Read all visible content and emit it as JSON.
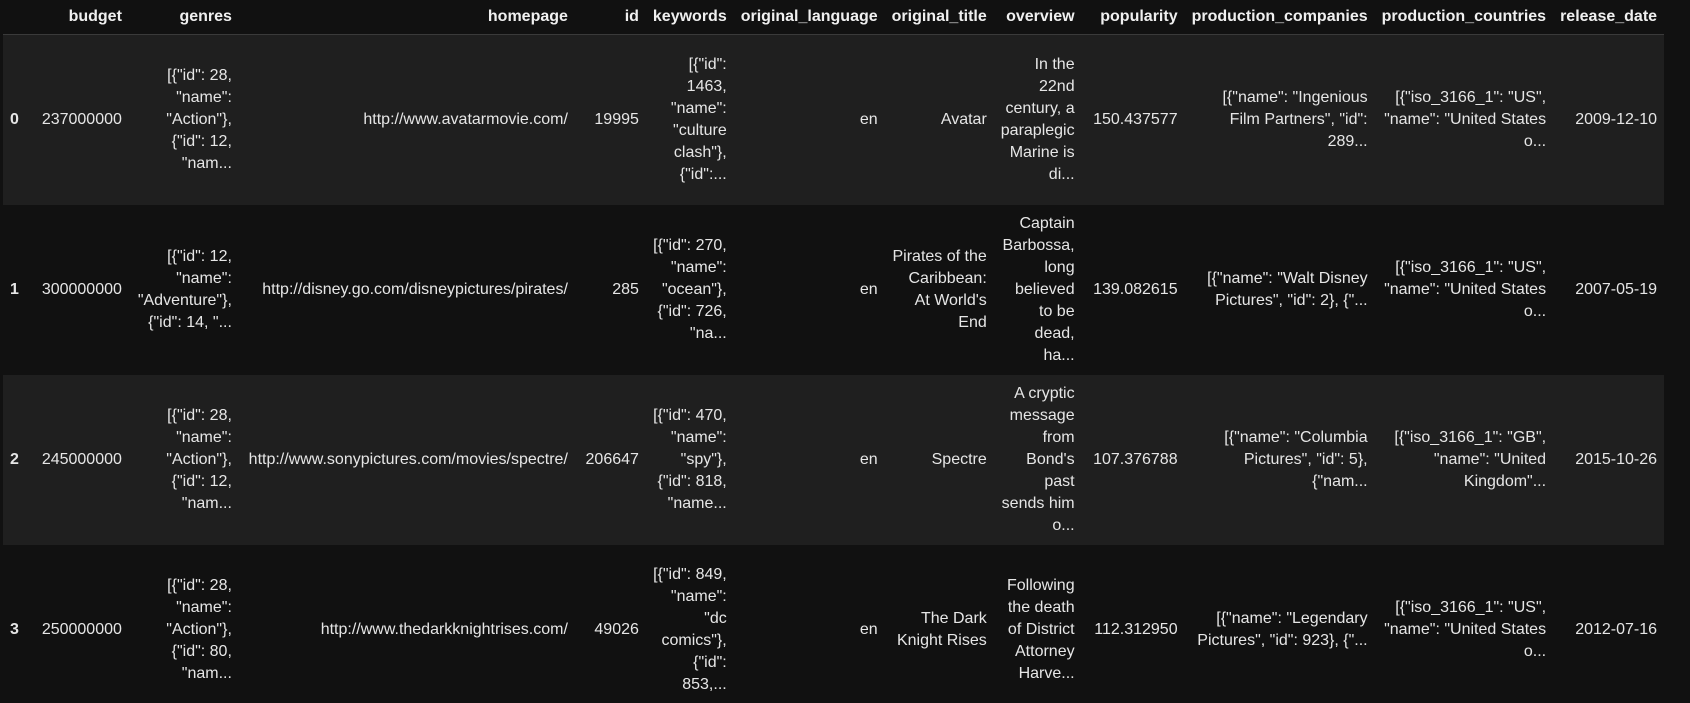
{
  "columns": [
    "",
    "budget",
    "genres",
    "homepage",
    "id",
    "keywords",
    "original_language",
    "original_title",
    "overview",
    "popularity",
    "production_companies",
    "production_countries",
    "release_date"
  ],
  "rows": [
    {
      "index": "0",
      "budget": "237000000",
      "genres": "[{\"id\": 28, \"name\": \"Action\"}, {\"id\": 12, \"nam...",
      "homepage": "http://www.avatarmovie.com/",
      "id": "19995",
      "keywords": "[{\"id\": 1463, \"name\": \"culture clash\"}, {\"id\":...",
      "original_language": "en",
      "original_title": "Avatar",
      "overview": "In the 22nd century, a paraplegic Marine is di...",
      "popularity": "150.437577",
      "production_companies": "[{\"name\": \"Ingenious Film Partners\", \"id\": 289...",
      "production_countries": "[{\"iso_3166_1\": \"US\", \"name\": \"United States o...",
      "release_date": "2009-12-10"
    },
    {
      "index": "1",
      "budget": "300000000",
      "genres": "[{\"id\": 12, \"name\": \"Adventure\"}, {\"id\": 14, \"...",
      "homepage": "http://disney.go.com/disneypictures/pirates/",
      "id": "285",
      "keywords": "[{\"id\": 270, \"name\": \"ocean\"}, {\"id\": 726, \"na...",
      "original_language": "en",
      "original_title": "Pirates of the Caribbean: At World's End",
      "overview": "Captain Barbossa, long believed to be dead, ha...",
      "popularity": "139.082615",
      "production_companies": "[{\"name\": \"Walt Disney Pictures\", \"id\": 2}, {\"...",
      "production_countries": "[{\"iso_3166_1\": \"US\", \"name\": \"United States o...",
      "release_date": "2007-05-19"
    },
    {
      "index": "2",
      "budget": "245000000",
      "genres": "[{\"id\": 28, \"name\": \"Action\"}, {\"id\": 12, \"nam...",
      "homepage": "http://www.sonypictures.com/movies/spectre/",
      "id": "206647",
      "keywords": "[{\"id\": 470, \"name\": \"spy\"}, {\"id\": 818, \"name...",
      "original_language": "en",
      "original_title": "Spectre",
      "overview": "A cryptic message from Bond's past sends him o...",
      "popularity": "107.376788",
      "production_companies": "[{\"name\": \"Columbia Pictures\", \"id\": 5}, {\"nam...",
      "production_countries": "[{\"iso_3166_1\": \"GB\", \"name\": \"United Kingdom\"...",
      "release_date": "2015-10-26"
    },
    {
      "index": "3",
      "budget": "250000000",
      "genres": "[{\"id\": 28, \"name\": \"Action\"}, {\"id\": 80, \"nam...",
      "homepage": "http://www.thedarkknightrises.com/",
      "id": "49026",
      "keywords": "[{\"id\": 849, \"name\": \"dc comics\"}, {\"id\": 853,...",
      "original_language": "en",
      "original_title": "The Dark Knight Rises",
      "overview": "Following the death of District Attorney Harve...",
      "popularity": "112.312950",
      "production_companies": "[{\"name\": \"Legendary Pictures\", \"id\": 923}, {\"...",
      "production_countries": "[{\"iso_3166_1\": \"US\", \"name\": \"United States o...",
      "release_date": "2012-07-16"
    }
  ]
}
